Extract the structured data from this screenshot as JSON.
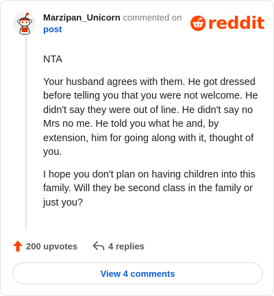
{
  "header": {
    "username": "Marzipan_Unicorn",
    "action_text": "commented on",
    "post_link": "post"
  },
  "logo": {
    "wordmark": "reddit",
    "icon": "reddit-snoo-icon",
    "color": "#ff4500"
  },
  "avatar": {
    "icon": "snoo-avatar-icon"
  },
  "comment": {
    "paragraphs": [
      "NTA",
      "Your husband agrees with them. He got dressed before telling you that you were not welcome. He didn't say they were out of line. He didn't say no Mrs no me. He told you what he and, by extension, him for going along with it, thought of you.",
      "I hope you don't plan on having children into this family. Will they be second class in the family or just you?"
    ]
  },
  "actions": {
    "upvotes_label": "200 upvotes",
    "upvote_icon": "upvote-arrow-icon",
    "upvote_color": "#ff4500",
    "replies_label": "4 replies",
    "reply_icon": "reply-arrow-icon"
  },
  "view_comments": {
    "label": "View 4 comments",
    "color": "#0b5bd3"
  }
}
